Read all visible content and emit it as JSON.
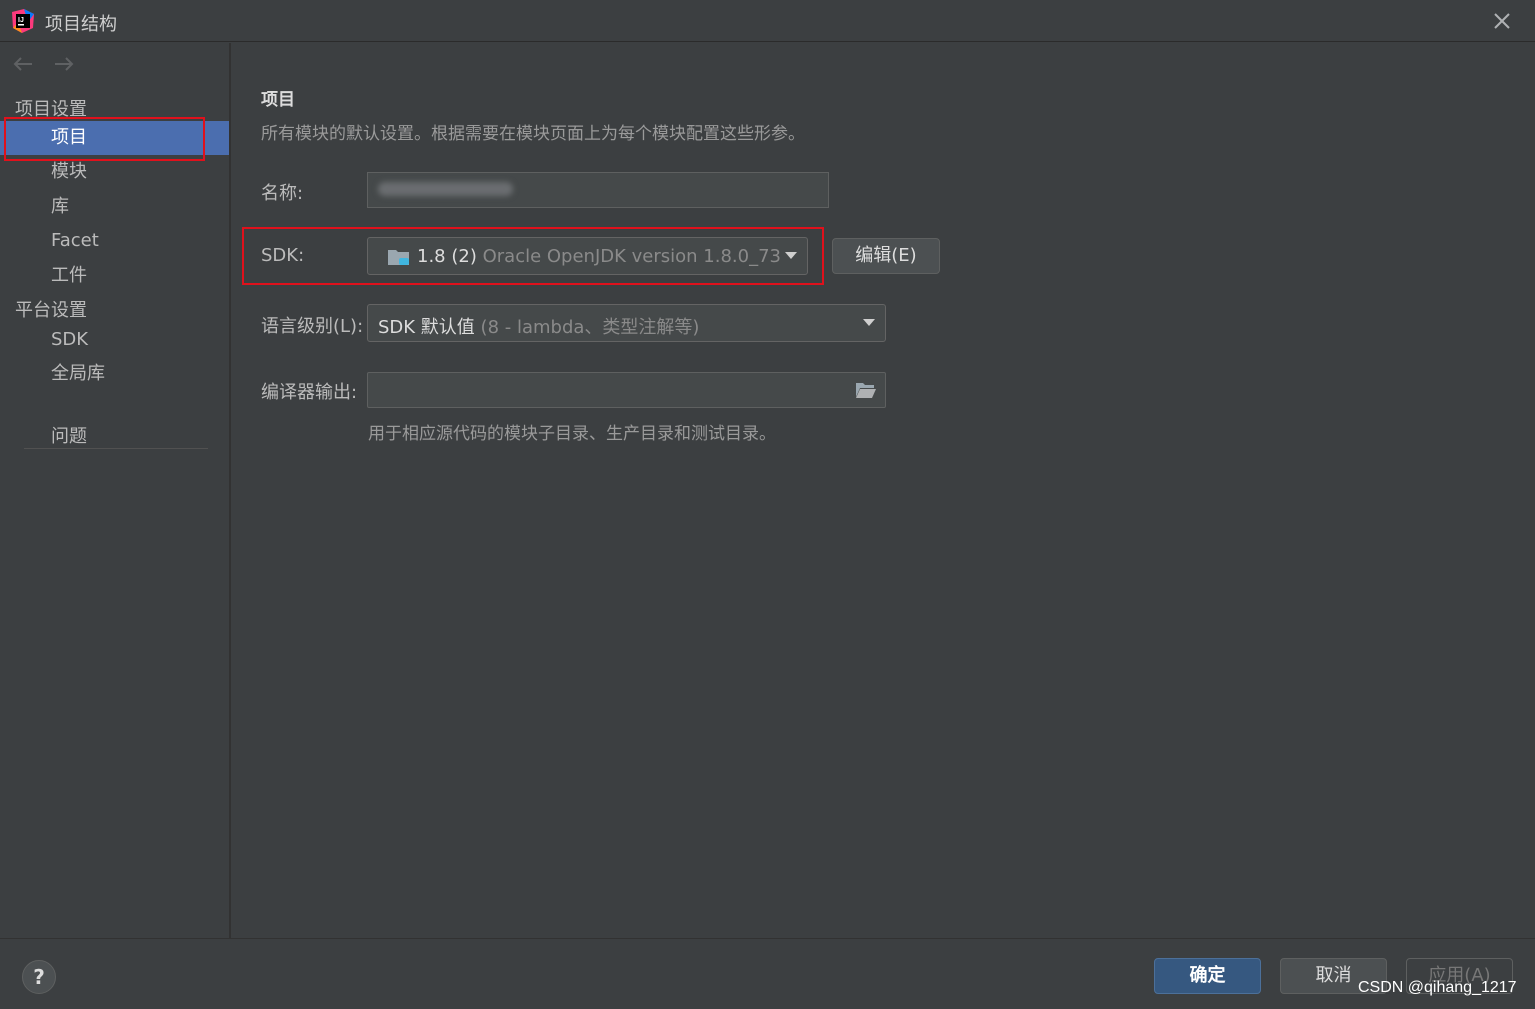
{
  "window": {
    "title": "项目结构",
    "close_icon": "close-icon",
    "app_icon": "intellij-idea-icon"
  },
  "sidebar": {
    "nav": {
      "back_icon": "arrow-left-icon",
      "forward_icon": "arrow-right-icon"
    },
    "group_project": "项目设置",
    "items_project": [
      {
        "label": "项目",
        "selected": true
      },
      {
        "label": "模块"
      },
      {
        "label": "库"
      },
      {
        "label": "Facet"
      },
      {
        "label": "工件"
      }
    ],
    "group_platform": "平台设置",
    "items_platform": [
      {
        "label": "SDK"
      },
      {
        "label": "全局库"
      }
    ],
    "problems": "问题"
  },
  "main": {
    "title": "项目",
    "description": "所有模块的默认设置。根据需要在模块页面上为每个模块配置这些形参。",
    "name_label": "名称:",
    "sdk_label": "SDK:",
    "sdk_value_main": "1.8 (2)",
    "sdk_value_detail": "Oracle OpenJDK version 1.8.0_73",
    "sdk_icon": "folder-jdk-icon",
    "edit_button": "编辑(E)",
    "lang_label": "语言级别(L):",
    "lang_value_main": "SDK 默认值",
    "lang_value_detail": "(8 - lambda、类型注解等)",
    "output_label": "编译器输出:",
    "output_value": "",
    "output_folder_icon": "folder-open-icon",
    "output_hint": "用于相应源代码的模块子目录、生产目录和测试目录。"
  },
  "footer": {
    "help": "?",
    "ok": "确定",
    "cancel": "取消",
    "apply": "应用(A)",
    "watermark": "CSDN @qihang_1217"
  },
  "colors": {
    "selection": "#4b6eaf",
    "highlight_box": "#e0111c",
    "primary_button": "#365880"
  }
}
